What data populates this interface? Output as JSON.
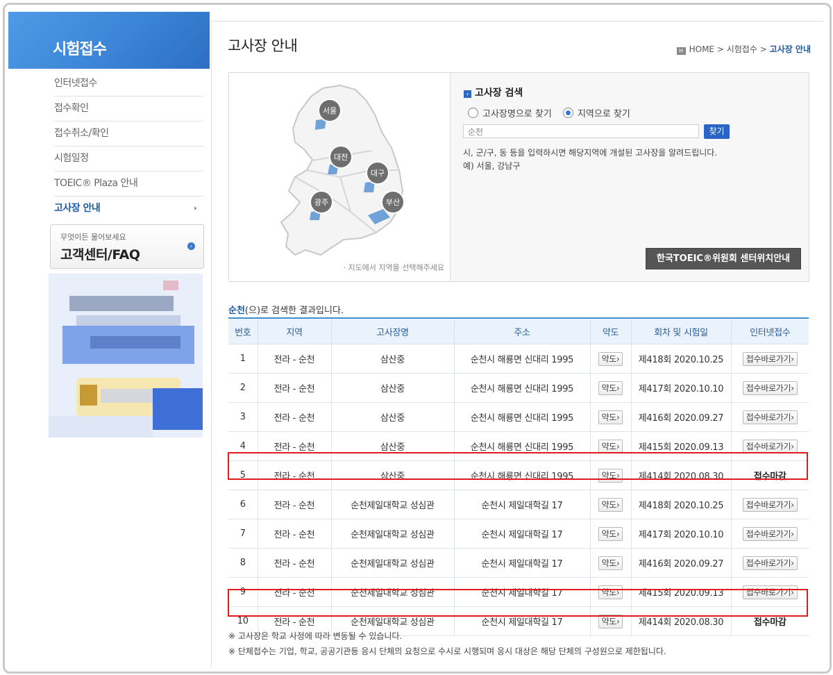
{
  "sidebar": {
    "title": "시험접수",
    "items": [
      {
        "label": "인터넷접수"
      },
      {
        "label": "접수확인"
      },
      {
        "label": "접수취소/확인"
      },
      {
        "label": "시험일정"
      },
      {
        "label": "TOEIC® Plaza 안내"
      },
      {
        "label": "고사장 안내",
        "active": true
      }
    ],
    "active_chevron": "›",
    "faq": {
      "sub": "무엇이든 물어보세요",
      "title": "고객센터/FAQ"
    }
  },
  "header": {
    "title": "고사장 안내",
    "breadcrumb": [
      "HOME",
      "시험접수",
      "고사장 안내"
    ],
    "breadcrumb_sep": ">"
  },
  "map": {
    "regions": [
      "서울",
      "대전",
      "대구",
      "광주",
      "부산"
    ],
    "hint": "· 지도에서 지역을 선택해주세요"
  },
  "search": {
    "title": "고사장 검색",
    "radio_name": "고사장명으로 찾기",
    "radio_region": "지역으로 찾기",
    "selected": "region",
    "input_value": "순천",
    "button": "찾기",
    "desc1": "시, 군/구, 동 등을 입력하시면 해당지역에 개설된 고사장을 알려드립니다.",
    "desc2": "예) 서울, 강남구",
    "center_button": "한국TOEIC®위원회 센터위치안내"
  },
  "result": {
    "keyword": "순천",
    "caption_rest": "(으)로 검색한 결과입니다.",
    "headers": [
      "번호",
      "지역",
      "고사장명",
      "주소",
      "약도",
      "회차 및 시험일",
      "인터넷접수"
    ],
    "map_btn": "약도",
    "apply_btn": "접수바로가기",
    "rows": [
      {
        "no": "1",
        "region": "전라 - 순천",
        "venue": "삼산중",
        "addr": "순천시 해룡면 신대리 1995",
        "session": "제418회 2020.10.25",
        "status": "접수바로가기"
      },
      {
        "no": "2",
        "region": "전라 - 순천",
        "venue": "삼산중",
        "addr": "순천시 해룡면 신대리 1995",
        "session": "제417회 2020.10.10",
        "status": "접수바로가기"
      },
      {
        "no": "3",
        "region": "전라 - 순천",
        "venue": "삼산중",
        "addr": "순천시 해룡면 신대리 1995",
        "session": "제416회 2020.09.27",
        "status": "접수바로가기"
      },
      {
        "no": "4",
        "region": "전라 - 순천",
        "venue": "삼산중",
        "addr": "순천시 해룡면 신대리 1995",
        "session": "제415회 2020.09.13",
        "status": "접수바로가기"
      },
      {
        "no": "5",
        "region": "전라 - 순천",
        "venue": "삼산중",
        "addr": "순천시 해룡면 신대리 1995",
        "session": "제414회 2020.08.30",
        "status": "접수마감"
      },
      {
        "no": "6",
        "region": "전라 - 순천",
        "venue": "순천제일대학교 성심관",
        "addr": "순천시 제일대학길 17",
        "session": "제418회 2020.10.25",
        "status": "접수바로가기"
      },
      {
        "no": "7",
        "region": "전라 - 순천",
        "venue": "순천제일대학교 성심관",
        "addr": "순천시 제일대학길 17",
        "session": "제417회 2020.10.10",
        "status": "접수바로가기"
      },
      {
        "no": "8",
        "region": "전라 - 순천",
        "venue": "순천제일대학교 성심관",
        "addr": "순천시 제일대학길 17",
        "session": "제416회 2020.09.27",
        "status": "접수바로가기"
      },
      {
        "no": "9",
        "region": "전라 - 순천",
        "venue": "순천제일대학교 성심관",
        "addr": "순천시 제일대학길 17",
        "session": "제415회 2020.09.13",
        "status": "접수바로가기"
      },
      {
        "no": "10",
        "region": "전라 - 순천",
        "venue": "순천제일대학교 성심관",
        "addr": "순천시 제일대학길 17",
        "session": "제414회 2020.08.30",
        "status": "접수마감"
      }
    ]
  },
  "notes": [
    "※ 고사장은 학교 사정에 따라 변동될 수 있습니다.",
    "※ 단체접수는 기업, 학교, 공공기관등 응시 단체의 요청으로 수시로 시행되며 응시 대상은 해당 단체의 구성원으로 제한됩니다."
  ],
  "colors": {
    "accent": "#1e5aa8",
    "highlight": "#e01b1b",
    "header_bg": "#3b84d6"
  }
}
